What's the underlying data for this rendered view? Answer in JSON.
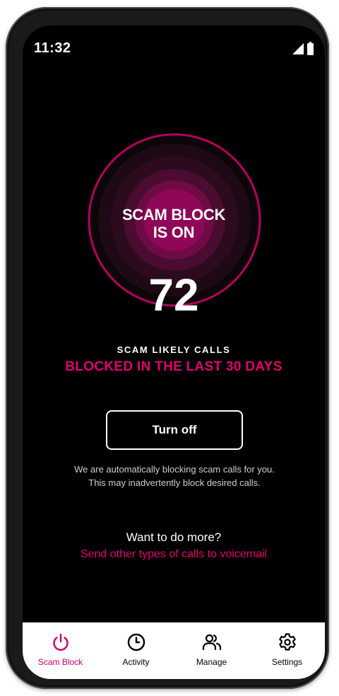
{
  "status_bar": {
    "time": "11:32"
  },
  "hero": {
    "ring_title_line1": "SCAM BLOCK",
    "ring_title_line2": "IS ON",
    "count": "72",
    "caption_line1": "SCAM LIKELY CALLS",
    "caption_line2": "BLOCKED IN THE LAST 30 DAYS"
  },
  "actions": {
    "turn_off_label": "Turn off",
    "disclaimer": "We are automatically blocking scam calls for you. This may inadvertently block desired calls."
  },
  "more": {
    "question": "Want to do more?",
    "link": "Send other types of calls to voicemail"
  },
  "nav": {
    "items": [
      {
        "label": "Scam Block",
        "icon": "power-icon",
        "active": true
      },
      {
        "label": "Activity",
        "icon": "clock-icon",
        "active": false
      },
      {
        "label": "Manage",
        "icon": "people-icon",
        "active": false
      },
      {
        "label": "Settings",
        "icon": "gear-icon",
        "active": false
      }
    ]
  },
  "colors": {
    "accent": "#e20074",
    "background": "#000000",
    "nav_background": "#ffffff"
  }
}
